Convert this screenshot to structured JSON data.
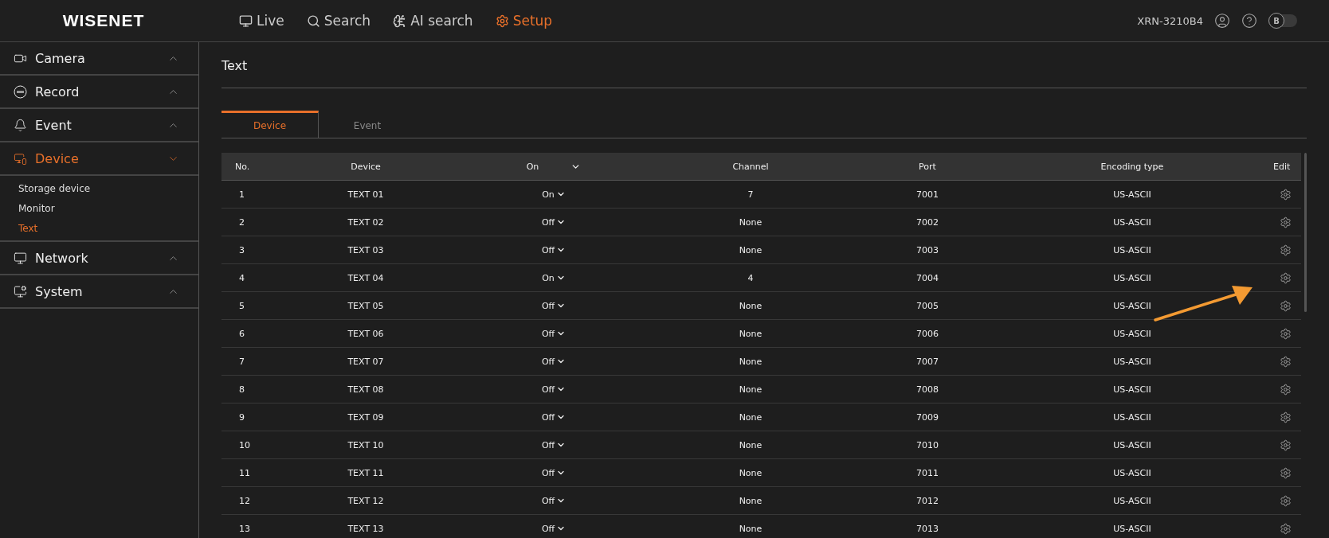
{
  "header": {
    "logo": "WISENET",
    "nav": [
      {
        "label": "Live",
        "selected": false
      },
      {
        "label": "Search",
        "selected": false
      },
      {
        "label": "AI search",
        "selected": false
      },
      {
        "label": "Setup",
        "selected": true
      }
    ],
    "device_name": "XRN-3210B4",
    "theme_toggle": "B"
  },
  "sidebar": {
    "items": [
      {
        "label": "Camera",
        "expanded": false,
        "selected": false
      },
      {
        "label": "Record",
        "expanded": false,
        "selected": false
      },
      {
        "label": "Event",
        "expanded": false,
        "selected": false
      },
      {
        "label": "Device",
        "expanded": true,
        "selected": true,
        "children": [
          {
            "label": "Storage device",
            "selected": false
          },
          {
            "label": "Monitor",
            "selected": false
          },
          {
            "label": "Text",
            "selected": true
          }
        ]
      },
      {
        "label": "Network",
        "expanded": false,
        "selected": false
      },
      {
        "label": "System",
        "expanded": false,
        "selected": false
      }
    ]
  },
  "page_title": "Text",
  "tabs": [
    {
      "label": "Device",
      "selected": true
    },
    {
      "label": "Event",
      "selected": false
    }
  ],
  "table": {
    "columns": [
      "No.",
      "Device",
      "On",
      "Channel",
      "Port",
      "Encoding type",
      "Edit"
    ],
    "rows": [
      {
        "no": "1",
        "device": "TEXT 01",
        "on": "On",
        "channel": "7",
        "port": "7001",
        "encoding": "US-ASCII"
      },
      {
        "no": "2",
        "device": "TEXT 02",
        "on": "Off",
        "channel": "None",
        "port": "7002",
        "encoding": "US-ASCII"
      },
      {
        "no": "3",
        "device": "TEXT 03",
        "on": "Off",
        "channel": "None",
        "port": "7003",
        "encoding": "US-ASCII"
      },
      {
        "no": "4",
        "device": "TEXT 04",
        "on": "On",
        "channel": "4",
        "port": "7004",
        "encoding": "US-ASCII"
      },
      {
        "no": "5",
        "device": "TEXT 05",
        "on": "Off",
        "channel": "None",
        "port": "7005",
        "encoding": "US-ASCII"
      },
      {
        "no": "6",
        "device": "TEXT 06",
        "on": "Off",
        "channel": "None",
        "port": "7006",
        "encoding": "US-ASCII"
      },
      {
        "no": "7",
        "device": "TEXT 07",
        "on": "Off",
        "channel": "None",
        "port": "7007",
        "encoding": "US-ASCII"
      },
      {
        "no": "8",
        "device": "TEXT 08",
        "on": "Off",
        "channel": "None",
        "port": "7008",
        "encoding": "US-ASCII"
      },
      {
        "no": "9",
        "device": "TEXT 09",
        "on": "Off",
        "channel": "None",
        "port": "7009",
        "encoding": "US-ASCII"
      },
      {
        "no": "10",
        "device": "TEXT 10",
        "on": "Off",
        "channel": "None",
        "port": "7010",
        "encoding": "US-ASCII"
      },
      {
        "no": "11",
        "device": "TEXT 11",
        "on": "Off",
        "channel": "None",
        "port": "7011",
        "encoding": "US-ASCII"
      },
      {
        "no": "12",
        "device": "TEXT 12",
        "on": "Off",
        "channel": "None",
        "port": "7012",
        "encoding": "US-ASCII"
      },
      {
        "no": "13",
        "device": "TEXT 13",
        "on": "Off",
        "channel": "None",
        "port": "7013",
        "encoding": "US-ASCII"
      }
    ]
  }
}
